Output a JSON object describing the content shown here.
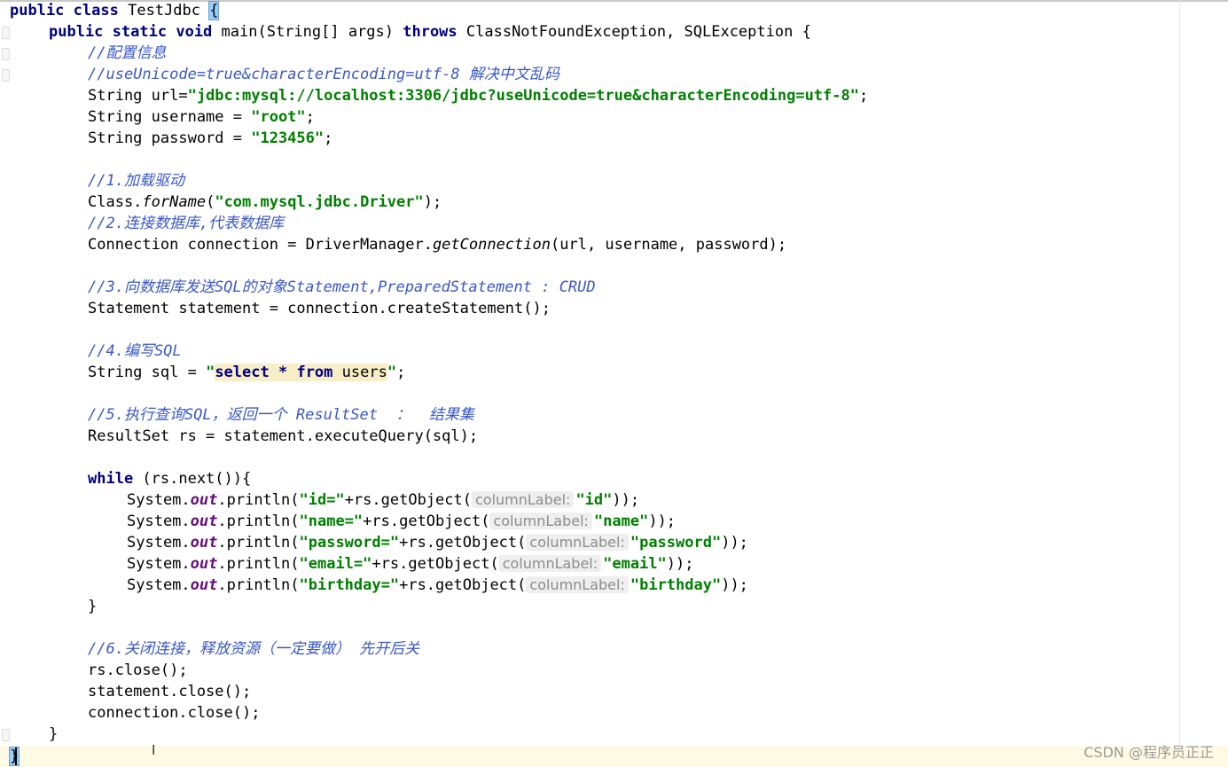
{
  "editor": {
    "language": "java",
    "watermark": "CSDN @程序员正正",
    "lines": {
      "l1": {
        "kw1": "public",
        "kw2": "class",
        "name": " TestJdbc ",
        "brace": "{"
      },
      "l2": {
        "kw1": "public",
        "kw2": "static",
        "kw3": "void",
        "sig": " main(String[] args) ",
        "kw4": "throws",
        "rest": " ClassNotFoundException, SQLException {"
      },
      "l3": {
        "comment": "//配置信息"
      },
      "l4": {
        "comment": "//useUnicode=true&characterEncoding=utf-8 解决中文乱码"
      },
      "l5": {
        "pre": "String url=",
        "str": "\"jdbc:mysql://localhost:3306/jdbc?useUnicode=true&characterEncoding=utf-8\"",
        "post": ";"
      },
      "l6": {
        "pre": "String username = ",
        "str": "\"root\"",
        "post": ";"
      },
      "l7": {
        "pre": "String password = ",
        "str": "\"123456\"",
        "post": ";"
      },
      "l9": {
        "comment": "//1.加载驱动"
      },
      "l10": {
        "pre": "Class.",
        "method": "forName",
        "open": "(",
        "str": "\"com.mysql.jdbc.Driver\"",
        "post": ");"
      },
      "l11": {
        "comment": "//2.连接数据库,代表数据库"
      },
      "l12": {
        "pre": "Connection connection = DriverManager.",
        "method": "getConnection",
        "post": "(url, username, password);"
      },
      "l14": {
        "comment": "//3.向数据库发送SQL的对象Statement,PreparedStatement : CRUD"
      },
      "l15": {
        "text": "Statement statement = connection.createStatement();"
      },
      "l17": {
        "comment": "//4.编写SQL"
      },
      "l18": {
        "pre": "String sql = ",
        "q1": "\"",
        "sel": "select",
        "mid": " * ",
        "from": "from",
        "tbl": " users",
        "q2": "\"",
        "post": ";"
      },
      "l20": {
        "comment": "//5.执行查询SQL，返回一个 ResultSet  ：  结果集"
      },
      "l21": {
        "text": "ResultSet rs = statement.executeQuery(sql);"
      },
      "l23": {
        "kw": "while",
        "rest": " (rs.next()){"
      },
      "l24": {
        "a": "System.",
        "out": "out",
        "b": ".println(",
        "s1": "\"id=\"",
        "c": "+rs.getObject(",
        "hint": "columnLabel:",
        "s2": "\"id\"",
        "d": "));"
      },
      "l25": {
        "a": "System.",
        "out": "out",
        "b": ".println(",
        "s1": "\"name=\"",
        "c": "+rs.getObject(",
        "hint": "columnLabel:",
        "s2": "\"name\"",
        "d": "));"
      },
      "l26": {
        "a": "System.",
        "out": "out",
        "b": ".println(",
        "s1": "\"password=\"",
        "c": "+rs.getObject(",
        "hint": "columnLabel:",
        "s2": "\"password\"",
        "d": "));"
      },
      "l27": {
        "a": "System.",
        "out": "out",
        "b": ".println(",
        "s1": "\"email=\"",
        "c": "+rs.getObject(",
        "hint": "columnLabel:",
        "s2": "\"email\"",
        "d": "));"
      },
      "l28": {
        "a": "System.",
        "out": "out",
        "b": ".println(",
        "s1": "\"birthday=\"",
        "c": "+rs.getObject(",
        "hint": "columnLabel:",
        "s2": "\"birthday\"",
        "d": "));"
      },
      "l29": {
        "text": "}"
      },
      "l31": {
        "comment": "//6.关闭连接，释放资源（一定要做） 先开后关"
      },
      "l32": {
        "text": "rs.close();"
      },
      "l33": {
        "text": "statement.close();"
      },
      "l34": {
        "text": "connection.close();"
      },
      "l35": {
        "text": "}"
      },
      "l36": {
        "text": "}"
      }
    }
  }
}
